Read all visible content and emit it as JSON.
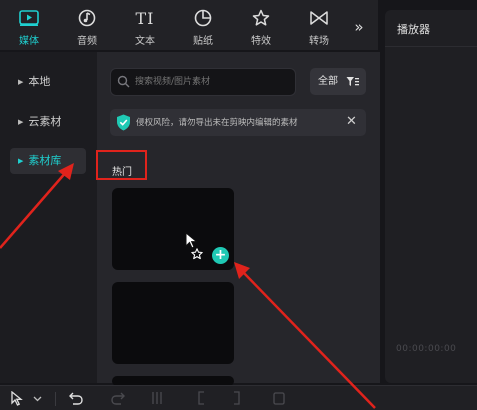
{
  "toolbar": {
    "items": [
      {
        "label": "媒体",
        "icon": "media-icon",
        "active": true
      },
      {
        "label": "音频",
        "icon": "audio-icon"
      },
      {
        "label": "文本",
        "icon": "text-icon"
      },
      {
        "label": "贴纸",
        "icon": "sticker-icon"
      },
      {
        "label": "特效",
        "icon": "effects-icon"
      },
      {
        "label": "转场",
        "icon": "transition-icon"
      }
    ],
    "more": "»"
  },
  "player": {
    "title": "播放器",
    "timecode": "00:00:00:00"
  },
  "sidebar": {
    "items": [
      {
        "label": "本地"
      },
      {
        "label": "云素材"
      },
      {
        "label": "素材库",
        "active": true
      }
    ]
  },
  "search": {
    "placeholder": "搜索视频/图片素材"
  },
  "filter": {
    "label": "全部"
  },
  "notice": {
    "text": "侵权风险，请勿导出未在剪映内编辑的素材"
  },
  "section": {
    "hot_label": "热门"
  },
  "add_button": "+",
  "colors": {
    "accent": "#1fd0d0",
    "annotation": "#e0231c",
    "add_button": "#1fc9b4"
  }
}
